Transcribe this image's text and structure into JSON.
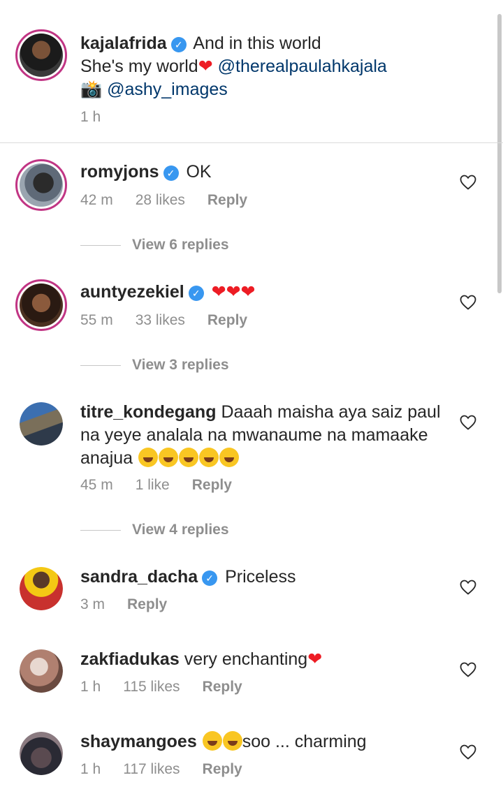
{
  "post": {
    "username": "kajalafrida",
    "text_a": "And in this world",
    "text_b": "She's my world",
    "heart": "❤",
    "mention1": "@therealpaulahkajala",
    "camera": "📸",
    "mention2": "@ashy_images",
    "time": "1 h"
  },
  "comments": [
    {
      "username": "romyjons",
      "text": "OK",
      "time": "42 m",
      "likes": "28 likes",
      "reply": "Reply",
      "view_replies": "View 6 replies"
    },
    {
      "username": "auntyezekiel",
      "text": "❤❤❤",
      "time": "55 m",
      "likes": "33 likes",
      "reply": "Reply",
      "view_replies": "View 3 replies"
    },
    {
      "username": "titre_kondegang",
      "text": "Daaah maisha aya saiz paul na yeye analala na mwanaume na mamaake anajua",
      "time": "45 m",
      "likes": "1 like",
      "reply": "Reply",
      "view_replies": "View 4 replies"
    },
    {
      "username": "sandra_dacha",
      "text": "Priceless",
      "time": "3 m",
      "reply": "Reply"
    },
    {
      "username": "zakfiadukas",
      "text": "very enchanting",
      "heart": "❤",
      "time": "1 h",
      "likes": "115 likes",
      "reply": "Reply"
    },
    {
      "username": "shaymangoes",
      "text": "soo ... charming",
      "time": "1 h",
      "likes": "117 likes",
      "reply": "Reply"
    }
  ],
  "icons": {
    "verified": "verified-badge-icon",
    "like": "heart-outline-icon"
  },
  "colors": {
    "verified": "#3897f0",
    "mention": "#00376b",
    "meta": "#8e8e8e",
    "story_ring": "#c13584",
    "heart": "#ed1c24"
  }
}
